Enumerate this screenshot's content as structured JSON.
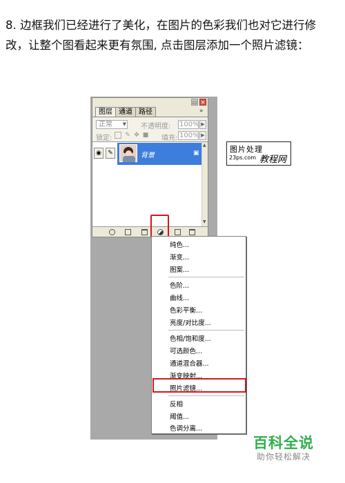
{
  "instruction": {
    "line1": "8. 边框我们已经进行了美化，在图片的色彩我们也对它进行修",
    "line2": "改，让整个图看起来更有氛围, 点击图层添加一个照片滤镜："
  },
  "layers_panel": {
    "tabs": [
      "图层",
      "通道",
      "路径"
    ],
    "window_buttons": {
      "minimize": "▭",
      "close": "✕"
    },
    "more": "»",
    "blend_mode": "正常",
    "opacity_label": "不透明度:",
    "opacity_value": "100%",
    "lock_label": "锁定:",
    "fill_label": "填充:",
    "fill_value": "100%",
    "layer": {
      "name": "背景",
      "locked": true
    }
  },
  "adjustment_menu": {
    "groups": [
      [
        "纯色...",
        "渐变...",
        "图案..."
      ],
      [
        "色阶...",
        "曲线...",
        "色彩平衡...",
        "亮度/对比度..."
      ],
      [
        "色相/饱和度...",
        "可选颜色...",
        "通道混合器...",
        "渐变映射...",
        "照片滤镜..."
      ],
      [
        "反相",
        "阈值...",
        "色调分离..."
      ]
    ],
    "highlighted_item": "照片滤镜..."
  },
  "watermark": {
    "line1": "图片处理",
    "line2": "23ps.com",
    "line3": "教程网"
  },
  "logo": {
    "main": "百科全说",
    "sub": "助你轻松解决"
  },
  "colors": {
    "highlight": "#d01818",
    "selection": "#3d7ddc",
    "logo": "#2fb04b"
  }
}
